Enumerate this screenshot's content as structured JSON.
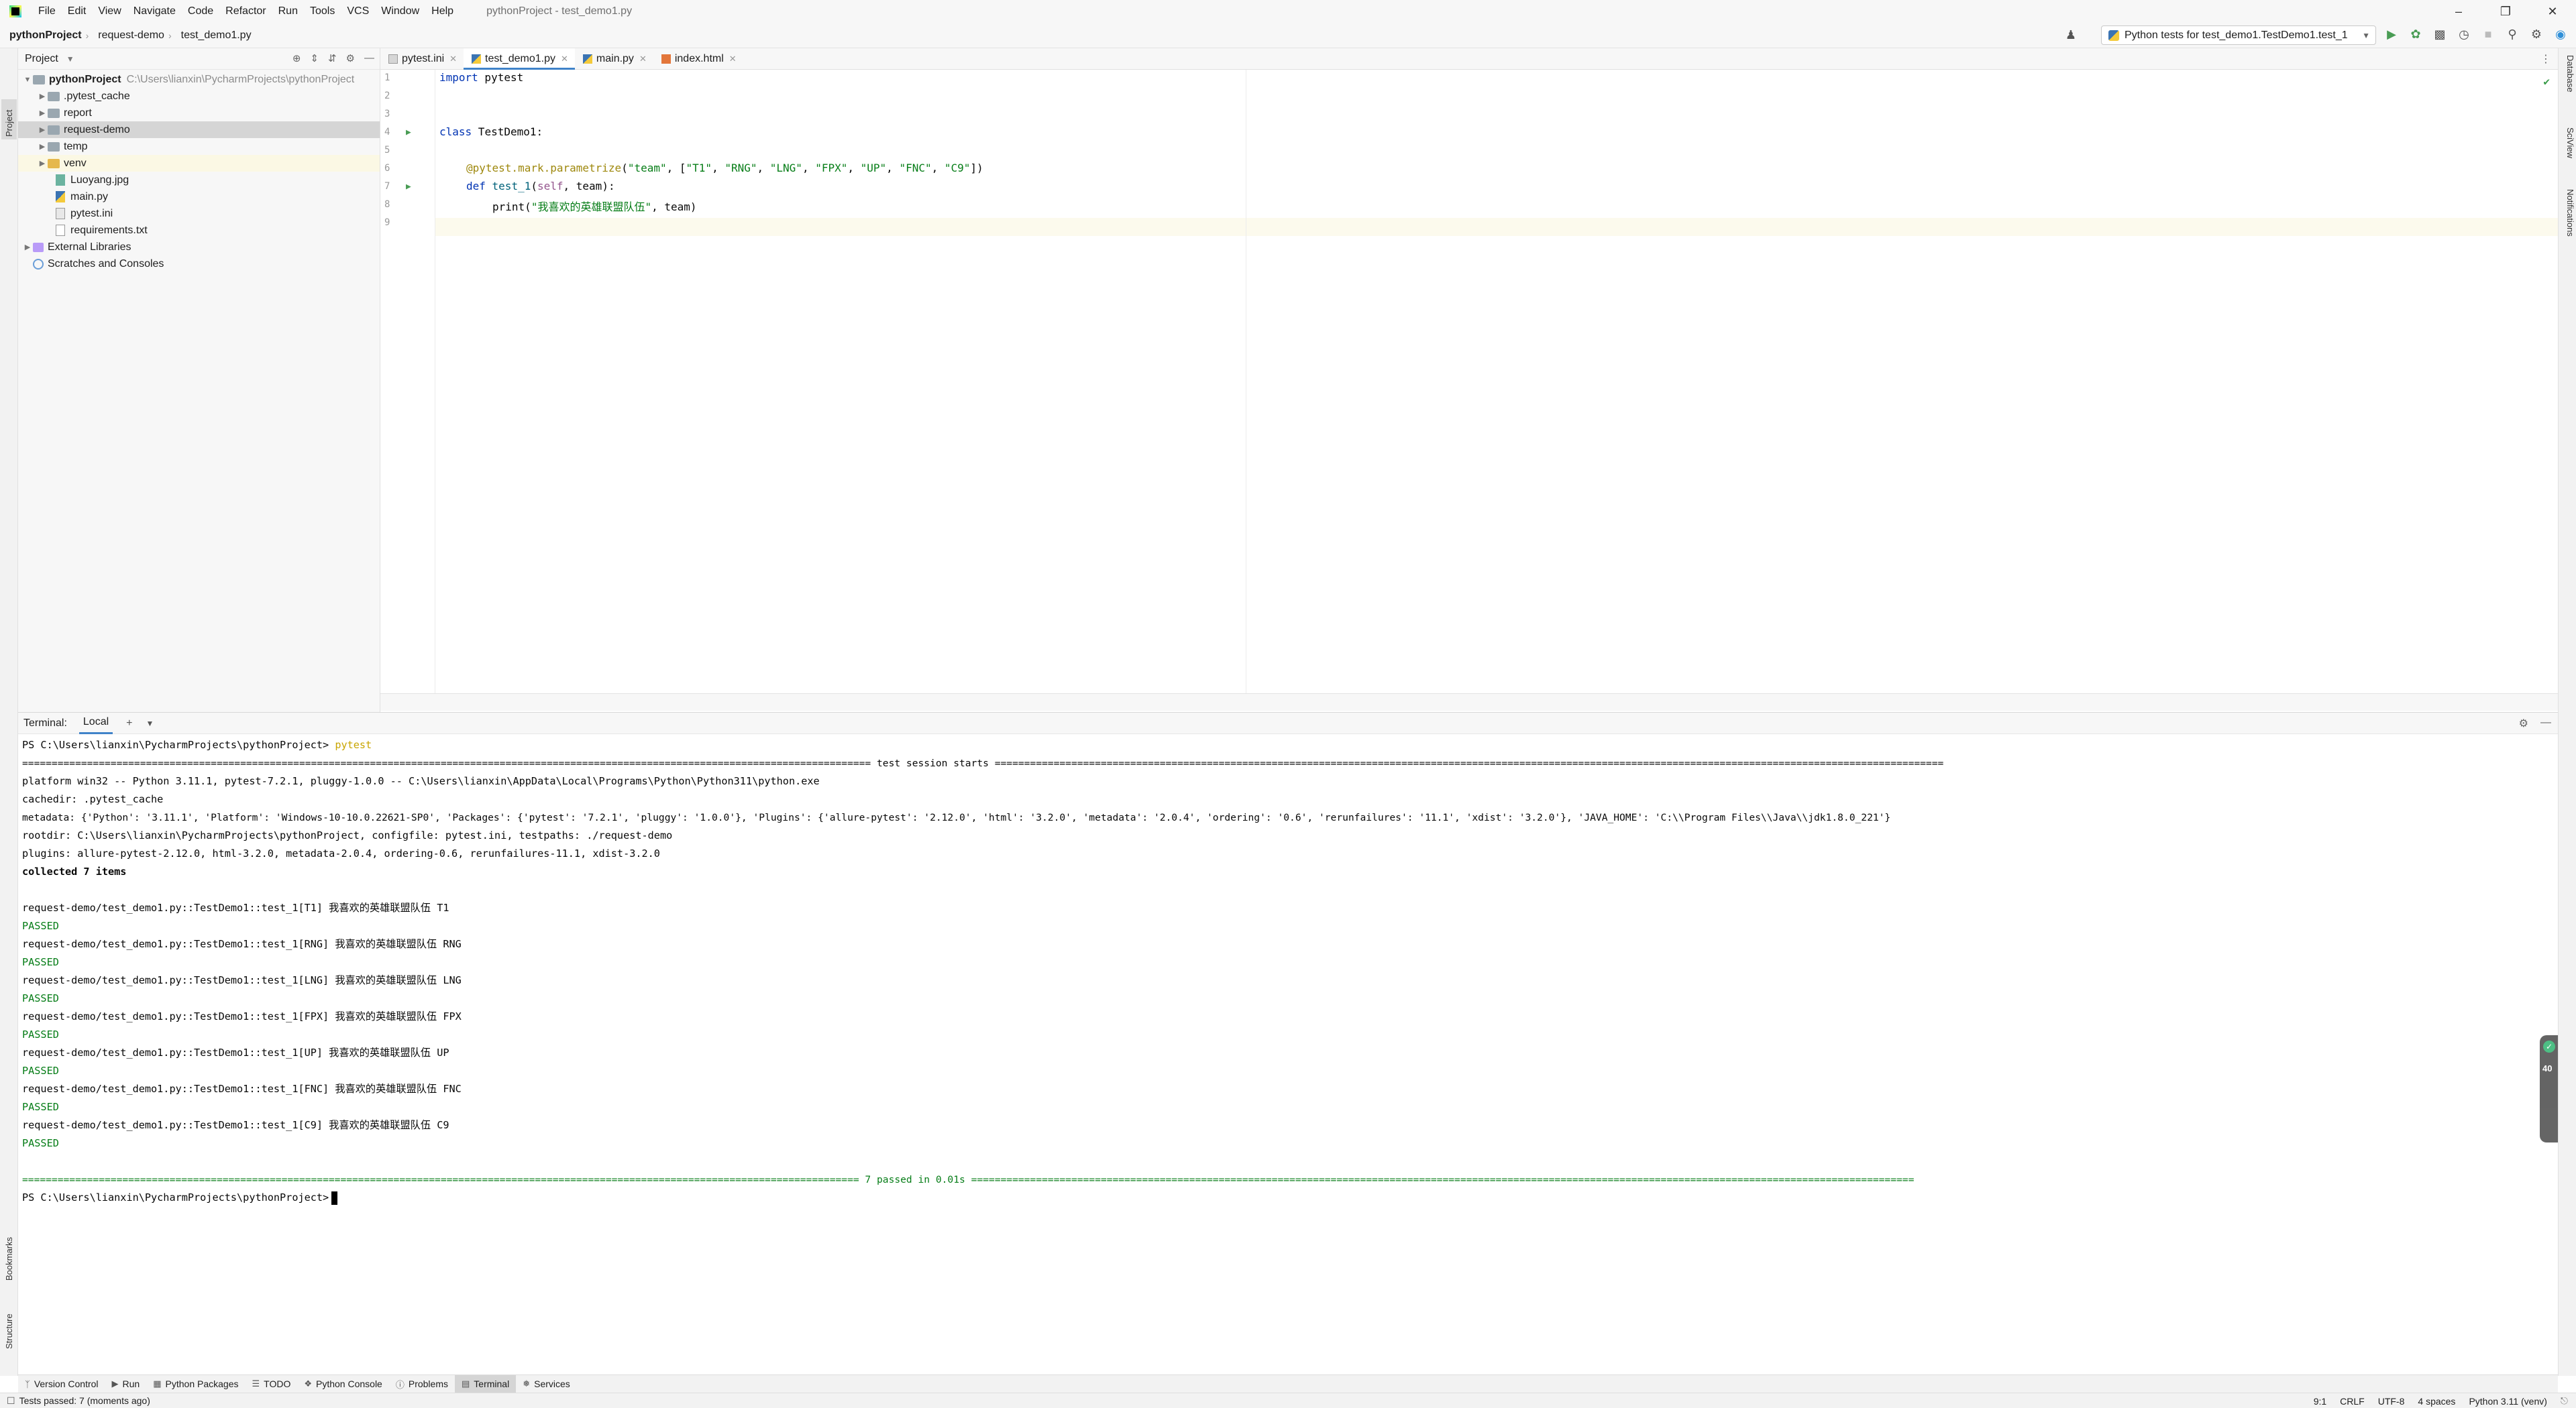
{
  "titlebar": {
    "menus": [
      "File",
      "Edit",
      "View",
      "Navigate",
      "Code",
      "Refactor",
      "Run",
      "Tools",
      "VCS",
      "Window",
      "Help"
    ],
    "title": "pythonProject - test_demo1.py"
  },
  "navbar": {
    "breadcrumbs": [
      "pythonProject",
      "request-demo",
      "test_demo1.py"
    ],
    "run_config": "Python tests for test_demo1.TestDemo1.test_1"
  },
  "left_strip": {
    "project": "Project",
    "bookmarks": "Bookmarks",
    "structure": "Structure"
  },
  "right_strip": {
    "database": "Database",
    "sciview": "SciView",
    "notifications": "Notifications"
  },
  "project_panel": {
    "header": "Project",
    "tree": [
      {
        "label": "pythonProject",
        "hint": "C:\\Users\\lianxin\\PycharmProjects\\pythonProject"
      },
      {
        "label": ".pytest_cache"
      },
      {
        "label": "report"
      },
      {
        "label": "request-demo"
      },
      {
        "label": "temp"
      },
      {
        "label": "venv"
      },
      {
        "label": "Luoyang.jpg"
      },
      {
        "label": "main.py"
      },
      {
        "label": "pytest.ini"
      },
      {
        "label": "requirements.txt"
      },
      {
        "label": "External Libraries"
      },
      {
        "label": "Scratches and Consoles"
      }
    ]
  },
  "editor": {
    "tabs": [
      "pytest.ini",
      "test_demo1.py",
      "main.py",
      "index.html"
    ],
    "active_tab": "test_demo1.py",
    "line_numbers": [
      "1",
      "2",
      "3",
      "4",
      "5",
      "6",
      "7",
      "8",
      "9"
    ],
    "code": {
      "l1_kw": "import",
      "l1_rest": " pytest",
      "l4_kw": "class",
      "l4_rest": " TestDemo1:",
      "l6_deco": "@pytest.mark.parametrize",
      "l6_p1": "(",
      "l6_s1": "\"team\"",
      "l6_p2": ", [",
      "l6_s2": "\"T1\"",
      "l6_c1": ", ",
      "l6_s3": "\"RNG\"",
      "l6_c2": ", ",
      "l6_s4": "\"LNG\"",
      "l6_c3": ", ",
      "l6_s5": "\"FPX\"",
      "l6_c4": ", ",
      "l6_s6": "\"UP\"",
      "l6_c5": ", ",
      "l6_s7": "\"FNC\"",
      "l6_c6": ", ",
      "l6_s8": "\"C9\"",
      "l6_end": "])",
      "l7_kw": "def",
      "l7_fn": " test_1",
      "l7_p1": "(",
      "l7_self": "self",
      "l7_rest": ", team):",
      "l8_fn": "print",
      "l8_p1": "(",
      "l8_str": "\"我喜欢的英雄联盟队伍\"",
      "l8_rest": ", team)"
    }
  },
  "terminal": {
    "label": "Terminal:",
    "tab": "Local",
    "prompt": "PS C:\\Users\\lianxin\\PycharmProjects\\pythonProject>",
    "command": " pytest",
    "lines": {
      "session": "================================================================================================================================================ test session starts =================================================================================================================================================================",
      "platform": "platform win32 -- Python 3.11.1, pytest-7.2.1, pluggy-1.0.0 -- C:\\Users\\lianxin\\AppData\\Local\\Programs\\Python\\Python311\\python.exe",
      "cachedir": "cachedir: .pytest_cache",
      "metadata": "metadata: {'Python': '3.11.1', 'Platform': 'Windows-10-10.0.22621-SP0', 'Packages': {'pytest': '7.2.1', 'pluggy': '1.0.0'}, 'Plugins': {'allure-pytest': '2.12.0', 'html': '3.2.0', 'metadata': '2.0.4', 'ordering': '0.6', 'rerunfailures': '11.1', 'xdist': '3.2.0'}, 'JAVA_HOME': 'C:\\\\Program Files\\\\Java\\\\jdk1.8.0_221'}",
      "rootdir": "rootdir: C:\\Users\\lianxin\\PycharmProjects\\pythonProject, configfile: pytest.ini, testpaths: ./request-demo",
      "plugins": "plugins: allure-pytest-2.12.0, html-3.2.0, metadata-2.0.4, ordering-0.6, rerunfailures-11.1, xdist-3.2.0",
      "collected": "collected 7 items",
      "t1": "request-demo/test_demo1.py::TestDemo1::test_1[T1] 我喜欢的英雄联盟队伍 T1",
      "t2": "request-demo/test_demo1.py::TestDemo1::test_1[RNG] 我喜欢的英雄联盟队伍 RNG",
      "t3": "request-demo/test_demo1.py::TestDemo1::test_1[LNG] 我喜欢的英雄联盟队伍 LNG",
      "t4": "request-demo/test_demo1.py::TestDemo1::test_1[FPX] 我喜欢的英雄联盟队伍 FPX",
      "t5": "request-demo/test_demo1.py::TestDemo1::test_1[UP] 我喜欢的英雄联盟队伍 UP",
      "t6": "request-demo/test_demo1.py::TestDemo1::test_1[FNC] 我喜欢的英雄联盟队伍 FNC",
      "t7": "request-demo/test_demo1.py::TestDemo1::test_1[C9] 我喜欢的英雄联盟队伍 C9",
      "passed": "PASSED",
      "summary": "============================================================================================================================================== 7 passed in 0.01s ================================================================================================================================================================"
    }
  },
  "perf_widget": {
    "value": "40"
  },
  "bottom_bar": [
    "Version Control",
    "Run",
    "Python Packages",
    "TODO",
    "Python Console",
    "Problems",
    "Terminal",
    "Services"
  ],
  "statusbar": {
    "message": "Tests passed: 7 (moments ago)",
    "position": "9:1",
    "line_sep": "CRLF",
    "encoding": "UTF-8",
    "indent": "4 spaces",
    "interpreter": "Python 3.11 (venv)"
  },
  "colors": {
    "accent": "#4083c9",
    "passed": "#067d17",
    "keyword": "#0033b3",
    "decorator": "#9e880d"
  }
}
